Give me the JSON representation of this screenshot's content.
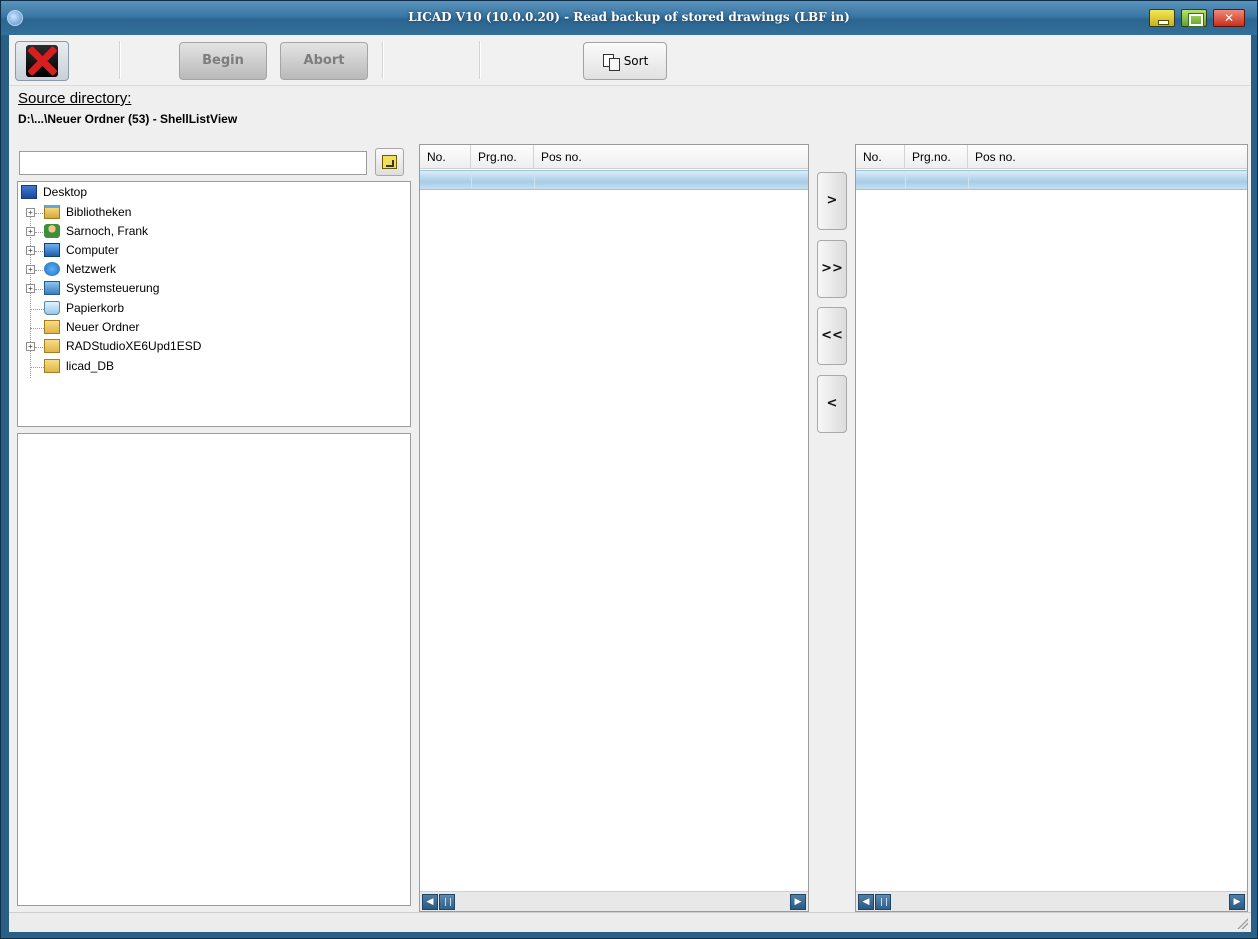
{
  "window": {
    "title": "LICAD V10 (10.0.0.20) - Read backup of stored drawings   (LBF in)"
  },
  "toolbar": {
    "exit_icon": "red-x-exit-icon",
    "begin_label": "Begin",
    "abort_label": "Abort",
    "sort_label": "Sort",
    "sort_icon": "sort-icon"
  },
  "source": {
    "label": "Source directory:",
    "path": "D:\\...\\Neuer Ordner (53) - ShellListView"
  },
  "path_field": {
    "value": ""
  },
  "tree": {
    "items": [
      {
        "label": "Desktop",
        "icon": "desktop-icon"
      },
      {
        "label": "Bibliotheken",
        "icon": "libraries-icon"
      },
      {
        "label": "Sarnoch, Frank",
        "icon": "user-icon"
      },
      {
        "label": "Computer",
        "icon": "computer-icon"
      },
      {
        "label": "Netzwerk",
        "icon": "network-icon"
      },
      {
        "label": "Systemsteuerung",
        "icon": "control-panel-icon"
      },
      {
        "label": "Papierkorb",
        "icon": "recycle-bin-icon"
      },
      {
        "label": "Neuer Ordner",
        "icon": "folder-icon"
      },
      {
        "label": "RADStudioXE6Upd1ESD",
        "icon": "folder-icon"
      },
      {
        "label": "licad_DB",
        "icon": "folder-icon"
      }
    ]
  },
  "left_list": {
    "columns": [
      "No.",
      "Prg.no.",
      "Pos no."
    ]
  },
  "right_list": {
    "columns": [
      "No.",
      "Prg.no.",
      "Pos no."
    ]
  },
  "transfer": {
    "add_one": ">",
    "add_all": ">>",
    "remove_all": "<<",
    "remove_one": "<"
  },
  "colors": {
    "title_bar": "#3a77a4",
    "selection_row": "#a7cde6",
    "client_bg": "#efefef"
  }
}
